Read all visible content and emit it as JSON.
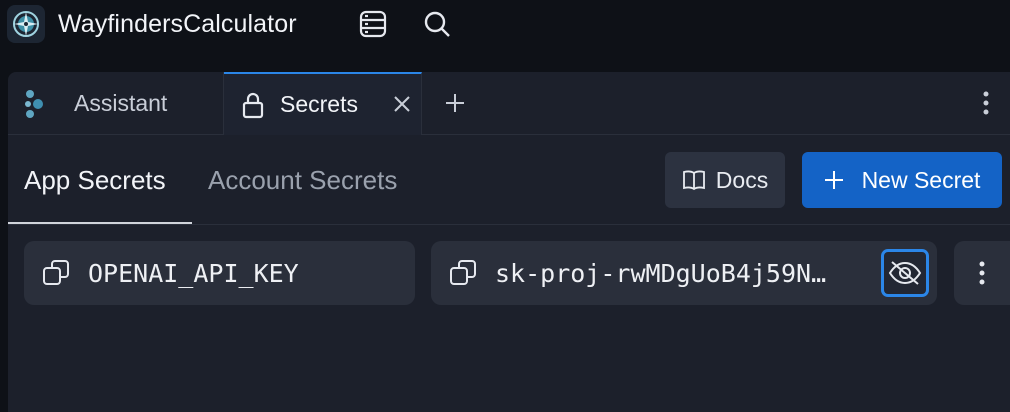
{
  "app": {
    "title": "WayfindersCalculator",
    "logo_icon": "compass-icon"
  },
  "toolbar": {
    "icons": [
      "database-icon",
      "search-icon"
    ]
  },
  "tabs": [
    {
      "label": "Assistant",
      "icon": "assistant-icon",
      "active": false
    },
    {
      "label": "Secrets",
      "icon": "lock-icon",
      "active": true,
      "closable": true
    }
  ],
  "subnav": {
    "tabs": [
      {
        "label": "App Secrets",
        "active": true
      },
      {
        "label": "Account Secrets",
        "active": false
      }
    ]
  },
  "actions": {
    "docs_label": "Docs",
    "new_secret_label": "New Secret"
  },
  "secrets": [
    {
      "key": "OPENAI_API_KEY",
      "value": "sk-proj-rwMDgUoB4j59N…"
    }
  ],
  "colors": {
    "background": "#0e1117",
    "panel": "#1c202b",
    "field": "#2a2f3b",
    "accent": "#1463c6",
    "focus": "#2b86e8"
  }
}
